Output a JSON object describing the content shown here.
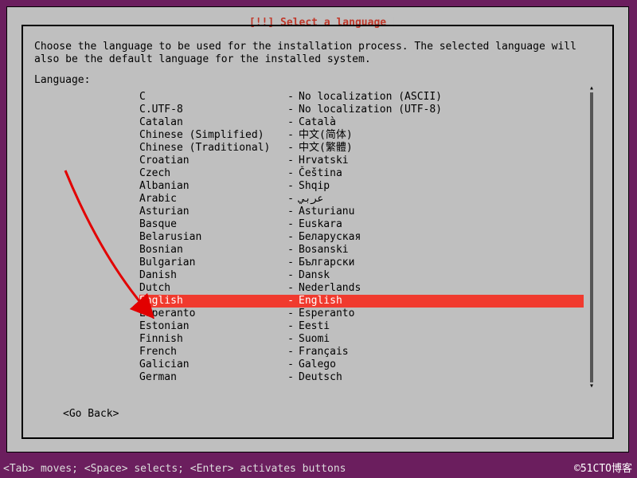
{
  "title": "[!!] Select a language",
  "description": "Choose the language to be used for the installation process. The selected language will also be the default language for the installed system.",
  "label": "Language:",
  "sep": "-",
  "languages": [
    {
      "name": "C",
      "native": "No localization (ASCII)"
    },
    {
      "name": "C.UTF-8",
      "native": "No localization (UTF-8)"
    },
    {
      "name": "Catalan",
      "native": "Català"
    },
    {
      "name": "Chinese (Simplified)",
      "native": "中文(简体)"
    },
    {
      "name": "Chinese (Traditional)",
      "native": "中文(繁體)"
    },
    {
      "name": "Croatian",
      "native": "Hrvatski"
    },
    {
      "name": "Czech",
      "native": "Čeština"
    },
    {
      "name": "Albanian",
      "native": "Shqip"
    },
    {
      "name": "Arabic",
      "native": "عربي"
    },
    {
      "name": "Asturian",
      "native": "Asturianu"
    },
    {
      "name": "Basque",
      "native": "Euskara"
    },
    {
      "name": "Belarusian",
      "native": "Беларуская"
    },
    {
      "name": "Bosnian",
      "native": "Bosanski"
    },
    {
      "name": "Bulgarian",
      "native": "Български"
    },
    {
      "name": "Danish",
      "native": "Dansk"
    },
    {
      "name": "Dutch",
      "native": "Nederlands"
    },
    {
      "name": "English",
      "native": "English",
      "selected": true
    },
    {
      "name": "Esperanto",
      "native": "Esperanto"
    },
    {
      "name": "Estonian",
      "native": "Eesti"
    },
    {
      "name": "Finnish",
      "native": "Suomi"
    },
    {
      "name": "French",
      "native": "Français"
    },
    {
      "name": "Galician",
      "native": "Galego"
    },
    {
      "name": "German",
      "native": "Deutsch"
    }
  ],
  "go_back": "<Go Back>",
  "hint": "<Tab> moves; <Space> selects; <Enter> activates buttons",
  "watermark": "©51CTO博客",
  "colors": {
    "bg": "#6b1e5e",
    "panel": "#bfbfbf",
    "highlight": "#f03a2e",
    "title": "#c0392b"
  }
}
